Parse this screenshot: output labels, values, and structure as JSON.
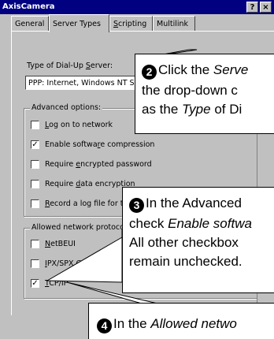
{
  "window": {
    "title": "AxisCamera",
    "help_btn": "?",
    "close_btn": "×"
  },
  "tabs": [
    {
      "label": "General"
    },
    {
      "label": "Server Types"
    },
    {
      "label": "Scripting"
    },
    {
      "label": "Multilink"
    }
  ],
  "form": {
    "dialup_label_pre": "Type of Dial-Up ",
    "dialup_label_u": "S",
    "dialup_label_post": "erver:",
    "dialup_value": "PPP: Internet, Windows NT S"
  },
  "advanced": {
    "title": "Advanced options:",
    "items": [
      {
        "pre": "",
        "u": "L",
        "post": "og on to network",
        "checked": false
      },
      {
        "pre": "Enable softwa",
        "u": "r",
        "post": "e compression",
        "checked": true
      },
      {
        "pre": "Require ",
        "u": "e",
        "post": "ncrypted password",
        "checked": false
      },
      {
        "pre": "Require ",
        "u": "d",
        "post": "ata encryption",
        "checked": false
      },
      {
        "pre": "",
        "u": "R",
        "post": "ecord a log file for this connection",
        "checked": false
      }
    ]
  },
  "protocols": {
    "title": "Allowed network protocols:",
    "items": [
      {
        "pre": "",
        "u": "N",
        "post": "etBEUI",
        "checked": false
      },
      {
        "pre": "",
        "u": "I",
        "post": "PX/SPX Compatible",
        "checked": false
      },
      {
        "pre": "",
        "u": "T",
        "post": "CP/IP",
        "checked": true
      }
    ]
  },
  "callouts": {
    "c2": {
      "num": "2",
      "l1": "Click the Serve",
      "l1_plain": "Click the ",
      "l1_it": "Serve",
      "l2": "the drop-down c",
      "l3_pre": "as the ",
      "l3_it": "Type",
      "l3_post": " of Di"
    },
    "c3": {
      "num": "3",
      "l1": "In the Advanced",
      "l2_pre": "check ",
      "l2_it": "Enable softwa",
      "l3": "All other checkbox",
      "l4": "remain unchecked."
    },
    "c4": {
      "num": "4",
      "l1_pre": "In the ",
      "l1_it": "Allowed netwo"
    }
  }
}
